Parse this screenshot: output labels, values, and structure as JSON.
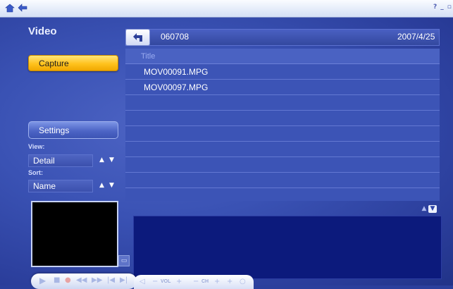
{
  "titlebar": {
    "home_icon": "home-icon",
    "back_icon": "back-arrow-icon",
    "help_glyph": "?",
    "minimize_glyph": "_",
    "restore_glyph": "▫",
    "close_glyph": "x"
  },
  "sidebar": {
    "section_title": "Video",
    "capture_label": "Capture",
    "settings_label": "Settings",
    "view_label": "View:",
    "view_value": "Detail",
    "sort_label": "Sort:",
    "sort_value": "Name"
  },
  "header": {
    "folder_name": "060708",
    "folder_date": "2007/4/25"
  },
  "file_list": {
    "column_title": "Title",
    "files": [
      "MOV00091.MPG",
      "MOV00097.MPG"
    ],
    "empty_rows": 7
  },
  "transport": {
    "vol_label": "VOL",
    "ch_label": "CH"
  },
  "colors": {
    "background": "#3a52b4",
    "capture_button": "#ffc21d",
    "description_box": "#0c1a7c"
  }
}
